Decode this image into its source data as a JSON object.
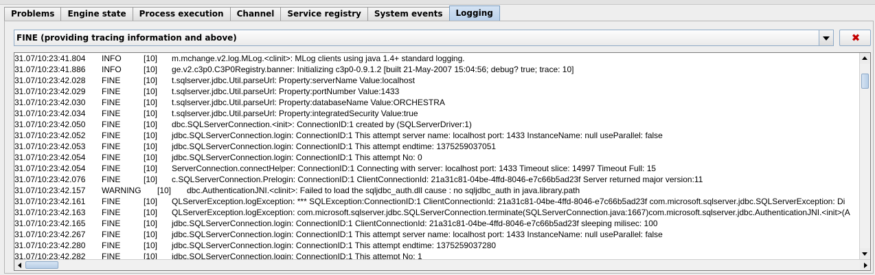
{
  "tabs": [
    {
      "label": "Problems",
      "active": false
    },
    {
      "label": "Engine state",
      "active": false
    },
    {
      "label": "Process execution",
      "active": false
    },
    {
      "label": "Channel",
      "active": false
    },
    {
      "label": "Service registry",
      "active": false
    },
    {
      "label": "System events",
      "active": false
    },
    {
      "label": "Logging",
      "active": true
    }
  ],
  "level_filter": {
    "selected": "FINE (providing tracing information and above)"
  },
  "clear_button": {
    "icon": "red-x-icon",
    "color": "#c40000"
  },
  "log": {
    "rows": [
      {
        "time": "31.07/10:23:41.804",
        "level": "INFO",
        "thread": "[10]",
        "message": "m.mchange.v2.log.MLog.<clinit>: MLog clients using java 1.4+ standard logging."
      },
      {
        "time": "31.07/10:23:41.886",
        "level": "INFO",
        "thread": "[10]",
        "message": "ge.v2.c3p0.C3P0Registry.banner: Initializing c3p0-0.9.1.2 [built 21-May-2007 15:04:56; debug? true; trace: 10]"
      },
      {
        "time": "31.07/10:23:42.028",
        "level": "FINE",
        "thread": "[10]",
        "message": "t.sqlserver.jdbc.Util.parseUrl: Property:serverName Value:localhost"
      },
      {
        "time": "31.07/10:23:42.029",
        "level": "FINE",
        "thread": "[10]",
        "message": "t.sqlserver.jdbc.Util.parseUrl: Property:portNumber Value:1433"
      },
      {
        "time": "31.07/10:23:42.030",
        "level": "FINE",
        "thread": "[10]",
        "message": "t.sqlserver.jdbc.Util.parseUrl: Property:databaseName Value:ORCHESTRA"
      },
      {
        "time": "31.07/10:23:42.034",
        "level": "FINE",
        "thread": "[10]",
        "message": "t.sqlserver.jdbc.Util.parseUrl: Property:integratedSecurity Value:true"
      },
      {
        "time": "31.07/10:23:42.050",
        "level": "FINE",
        "thread": "[10]",
        "message": "dbc.SQLServerConnection.<init>: ConnectionID:1 created by (SQLServerDriver:1)"
      },
      {
        "time": "31.07/10:23:42.052",
        "level": "FINE",
        "thread": "[10]",
        "message": "jdbc.SQLServerConnection.login: ConnectionID:1 This attempt server name: localhost port: 1433 InstanceName: null useParallel: false"
      },
      {
        "time": "31.07/10:23:42.053",
        "level": "FINE",
        "thread": "[10]",
        "message": "jdbc.SQLServerConnection.login: ConnectionID:1 This attempt endtime: 1375259037051"
      },
      {
        "time": "31.07/10:23:42.054",
        "level": "FINE",
        "thread": "[10]",
        "message": "jdbc.SQLServerConnection.login: ConnectionID:1 This attempt No: 0"
      },
      {
        "time": "31.07/10:23:42.054",
        "level": "FINE",
        "thread": "[10]",
        "message": "ServerConnection.connectHelper: ConnectionID:1 Connecting with server: localhost port: 1433 Timeout slice: 14997 Timeout Full: 15"
      },
      {
        "time": "31.07/10:23:42.076",
        "level": "FINE",
        "thread": "[10]",
        "message": "c.SQLServerConnection.Prelogin: ConnectionID:1 ClientConnectionId: 21a31c81-04be-4ffd-8046-e7c66b5ad23f Server returned major version:11"
      },
      {
        "time": "31.07/10:23:42.157",
        "level": "WARNING",
        "thread": "[10]",
        "message": "dbc.AuthenticationJNI.<clinit>: Failed to load the sqljdbc_auth.dll cause : no sqljdbc_auth in java.library.path",
        "warn": true
      },
      {
        "time": "31.07/10:23:42.161",
        "level": "FINE",
        "thread": "[10]",
        "message": "QLServerException.logException: *** SQLException:ConnectionID:1 ClientConnectionId: 21a31c81-04be-4ffd-8046-e7c66b5ad23f com.microsoft.sqlserver.jdbc.SQLServerException: Di"
      },
      {
        "time": "31.07/10:23:42.163",
        "level": "FINE",
        "thread": "[10]",
        "message": "QLServerException.logException: com.microsoft.sqlserver.jdbc.SQLServerConnection.terminate(SQLServerConnection.java:1667)com.microsoft.sqlserver.jdbc.AuthenticationJNI.<init>(A"
      },
      {
        "time": "31.07/10:23:42.165",
        "level": "FINE",
        "thread": "[10]",
        "message": "jdbc.SQLServerConnection.login: ConnectionID:1 ClientConnectionId: 21a31c81-04be-4ffd-8046-e7c66b5ad23f sleeping milisec: 100"
      },
      {
        "time": "31.07/10:23:42.267",
        "level": "FINE",
        "thread": "[10]",
        "message": "jdbc.SQLServerConnection.login: ConnectionID:1 This attempt server name: localhost port: 1433 InstanceName: null useParallel: false"
      },
      {
        "time": "31.07/10:23:42.280",
        "level": "FINE",
        "thread": "[10]",
        "message": "jdbc.SQLServerConnection.login: ConnectionID:1 This attempt endtime: 1375259037280"
      },
      {
        "time": "31.07/10:23:42.282",
        "level": "FINE",
        "thread": "[10]",
        "message": "jdbc.SQLServerConnection.login: ConnectionID:1 This attempt No: 1"
      }
    ]
  }
}
